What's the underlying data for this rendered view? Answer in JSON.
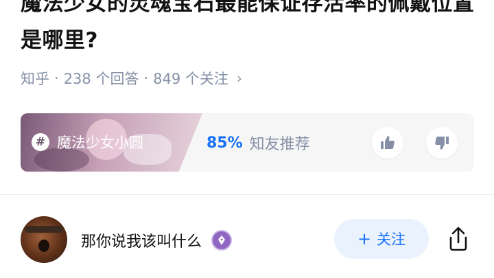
{
  "question": {
    "title": "魔法少女的灵魂宝石最能保证存活率的佩戴位置是哪里?",
    "source": "知乎",
    "answers": "238 个回答",
    "followers": "849 个关注",
    "separator": "·",
    "chevron": "›"
  },
  "topic_card": {
    "hash_icon": "#",
    "topic": "魔法少女小圆",
    "recommend_percent": "85%",
    "recommend_label": "知友推荐",
    "icons": [
      "thumb-up-icon",
      "thumb-down-icon"
    ]
  },
  "answer_author": {
    "name": "那你说我该叫什么",
    "badge_icon": "pen-nib-icon",
    "follow_plus": "+",
    "follow_label": "关注",
    "share_icon": "share-icon"
  },
  "colors": {
    "accent": "#1772f6",
    "meta_gray": "#8590a6",
    "follow_bg": "#eaf2fe",
    "badge_purple": "#8f67c2"
  }
}
